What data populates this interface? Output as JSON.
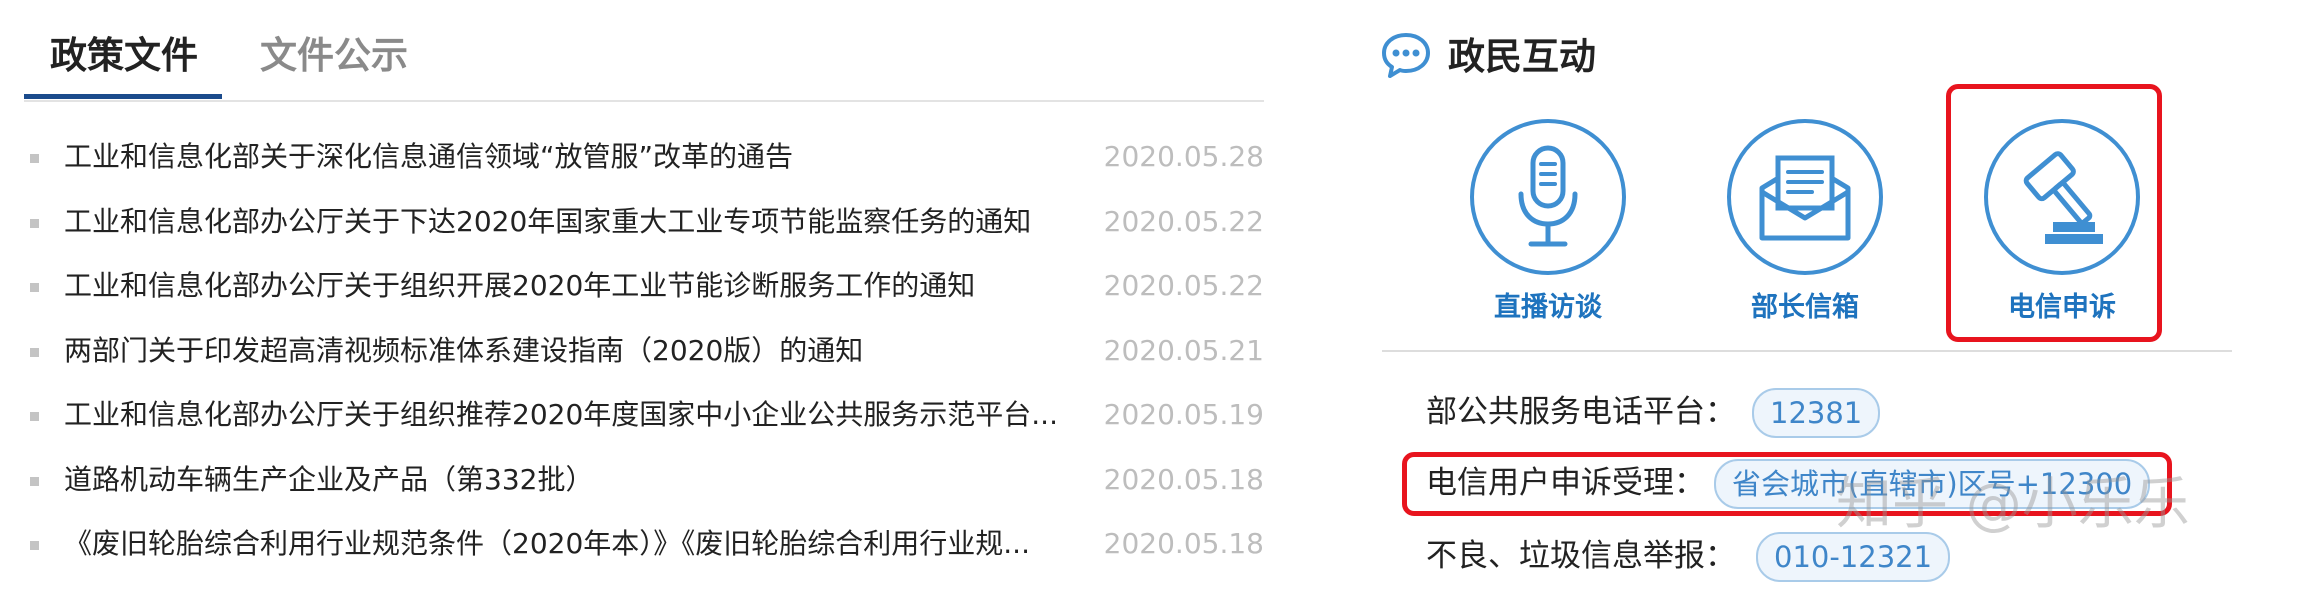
{
  "colors": {
    "accent_blue": "#1e73be",
    "tab_underline": "#1b4b8c",
    "highlight_red": "#e8141e",
    "date_gray": "#bdbdbd"
  },
  "policy_panel": {
    "tabs": [
      {
        "label": "政策文件",
        "active": true
      },
      {
        "label": "文件公示",
        "active": false
      }
    ],
    "items": [
      {
        "title": "工业和信息化部关于深化信息通信领域“放管服”改革的通告",
        "date": "2020.05.28"
      },
      {
        "title": "工业和信息化部办公厅关于下达2020年国家重大工业专项节能监察任务的通知",
        "date": "2020.05.22"
      },
      {
        "title": "工业和信息化部办公厅关于组织开展2020年工业节能诊断服务工作的通知",
        "date": "2020.05.22"
      },
      {
        "title": "两部门关于印发超高清视频标准体系建设指南（2020版）的通知",
        "date": "2020.05.21"
      },
      {
        "title": "工业和信息化部办公厅关于组织推荐2020年度国家中小企业公共服务示范平台...",
        "date": "2020.05.19"
      },
      {
        "title": "道路机动车辆生产企业及产品（第332批）",
        "date": "2020.05.18"
      },
      {
        "title": "《废旧轮胎综合利用行业规范条件（2020年本）》《废旧轮胎综合利用行业规...",
        "date": "2020.05.18"
      }
    ]
  },
  "interaction_panel": {
    "title": "政民互动",
    "title_icon": "chat-bubble-icon",
    "services": [
      {
        "label": "直播访谈",
        "icon": "microphone-icon"
      },
      {
        "label": "部长信箱",
        "icon": "mail-icon"
      },
      {
        "label": "电信申诉",
        "icon": "gavel-icon"
      }
    ],
    "contacts": [
      {
        "label": "部公共服务电话平台：",
        "value": "12381"
      },
      {
        "label": "电信用户申诉受理：",
        "value": "省会城市(直辖市)区号+12300"
      },
      {
        "label": "不良、垃圾信息举报：",
        "value": "010-12321"
      }
    ]
  },
  "watermark": "知乎 @小乐乐"
}
